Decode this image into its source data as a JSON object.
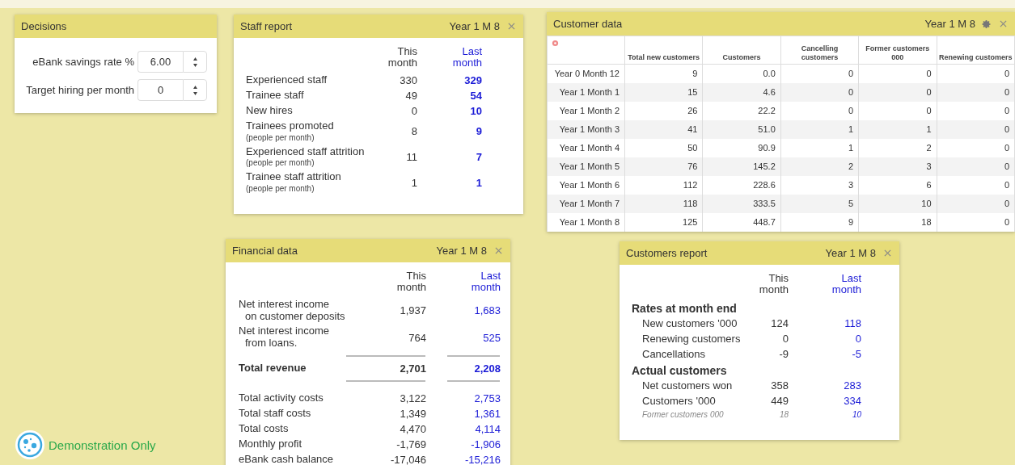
{
  "decisions": {
    "title": "Decisions",
    "fields": [
      {
        "label": "eBank savings rate %",
        "value": "6.00"
      },
      {
        "label": "Target hiring per month",
        "value": "0"
      }
    ]
  },
  "staff_report": {
    "title": "Staff report",
    "period": "Year 1 M 8",
    "columns": [
      "This month",
      "Last month"
    ],
    "rows": [
      {
        "label": "Experienced staff",
        "this": "330",
        "last": "329"
      },
      {
        "label": "Trainee staff",
        "this": "49",
        "last": "54"
      },
      {
        "label": "New hires",
        "this": "0",
        "last": "10"
      },
      {
        "label": "Trainees promoted",
        "note": "(people per month)",
        "this": "8",
        "last": "9"
      },
      {
        "label": "Experienced staff attrition",
        "note": "(people per month)",
        "this": "11",
        "last": "7"
      },
      {
        "label": "Trainee staff attrition",
        "note": "(people per month)",
        "this": "1",
        "last": "1"
      }
    ]
  },
  "customer_data": {
    "title": "Customer data",
    "period": "Year 1 M 8",
    "columns": [
      "Total new customers",
      "Customers",
      "Cancelling customers",
      "Former customers 000",
      "Renewing customers"
    ],
    "rows": [
      {
        "label": "Year 0 Month 12",
        "values": [
          "9",
          "0.0",
          "0",
          "0",
          "0"
        ]
      },
      {
        "label": "Year 1 Month 1",
        "values": [
          "15",
          "4.6",
          "0",
          "0",
          "0"
        ]
      },
      {
        "label": "Year 1 Month 2",
        "values": [
          "26",
          "22.2",
          "0",
          "0",
          "0"
        ]
      },
      {
        "label": "Year 1 Month 3",
        "values": [
          "41",
          "51.0",
          "1",
          "1",
          "0"
        ]
      },
      {
        "label": "Year 1 Month 4",
        "values": [
          "50",
          "90.9",
          "1",
          "2",
          "0"
        ]
      },
      {
        "label": "Year 1 Month 5",
        "values": [
          "76",
          "145.2",
          "2",
          "3",
          "0"
        ]
      },
      {
        "label": "Year 1 Month 6",
        "values": [
          "112",
          "228.6",
          "3",
          "6",
          "0"
        ]
      },
      {
        "label": "Year 1 Month 7",
        "values": [
          "118",
          "333.5",
          "5",
          "10",
          "0"
        ]
      },
      {
        "label": "Year 1 Month 8",
        "values": [
          "125",
          "448.7",
          "9",
          "18",
          "0"
        ]
      }
    ]
  },
  "financial_data": {
    "title": "Financial data",
    "period": "Year 1 M 8",
    "columns": [
      "This month",
      "Last month"
    ],
    "revenue": [
      {
        "label_lines": [
          "Net interest income",
          "on customer deposits"
        ],
        "this": "1,937",
        "last": "1,683"
      },
      {
        "label_lines": [
          "Net interest income",
          "from loans."
        ],
        "this": "764",
        "last": "525"
      }
    ],
    "total": {
      "label": "Total revenue",
      "this": "2,701",
      "last": "2,208"
    },
    "costs": [
      {
        "label": "Total activity costs",
        "this": "3,122",
        "last": "2,753"
      },
      {
        "label": "Total staff costs",
        "this": "1,349",
        "last": "1,361"
      },
      {
        "label": "Total costs",
        "this": "4,470",
        "last": "4,114"
      },
      {
        "label": "Monthly profit",
        "this": "-1,769",
        "last": "-1,906"
      },
      {
        "label": "eBank cash balance",
        "this": "-17,046",
        "last": "-15,216"
      }
    ]
  },
  "customers_report": {
    "title": "Customers report",
    "period": "Year 1 M 8",
    "columns": [
      "This month",
      "Last month"
    ],
    "sections": [
      {
        "heading": "Rates at month end",
        "rows": [
          {
            "label": "New customers '000",
            "this": "124",
            "last": "118",
            "kind": "normal"
          },
          {
            "label": "Renewing customers",
            "this": "0",
            "last": "0",
            "kind": "normal"
          },
          {
            "label": "Cancellations",
            "this": "-9",
            "last": "-5",
            "kind": "normal"
          }
        ]
      },
      {
        "heading": "Actual customers",
        "rows": [
          {
            "label": "Net customers won",
            "this": "358",
            "last": "283",
            "kind": "normal"
          },
          {
            "label": "Customers '000",
            "this": "449",
            "last": "334",
            "kind": "normal"
          },
          {
            "label": "Former customers 000",
            "this": "18",
            "last": "10",
            "kind": "minor"
          }
        ]
      }
    ]
  },
  "badge": {
    "text": "Demonstration Only"
  }
}
